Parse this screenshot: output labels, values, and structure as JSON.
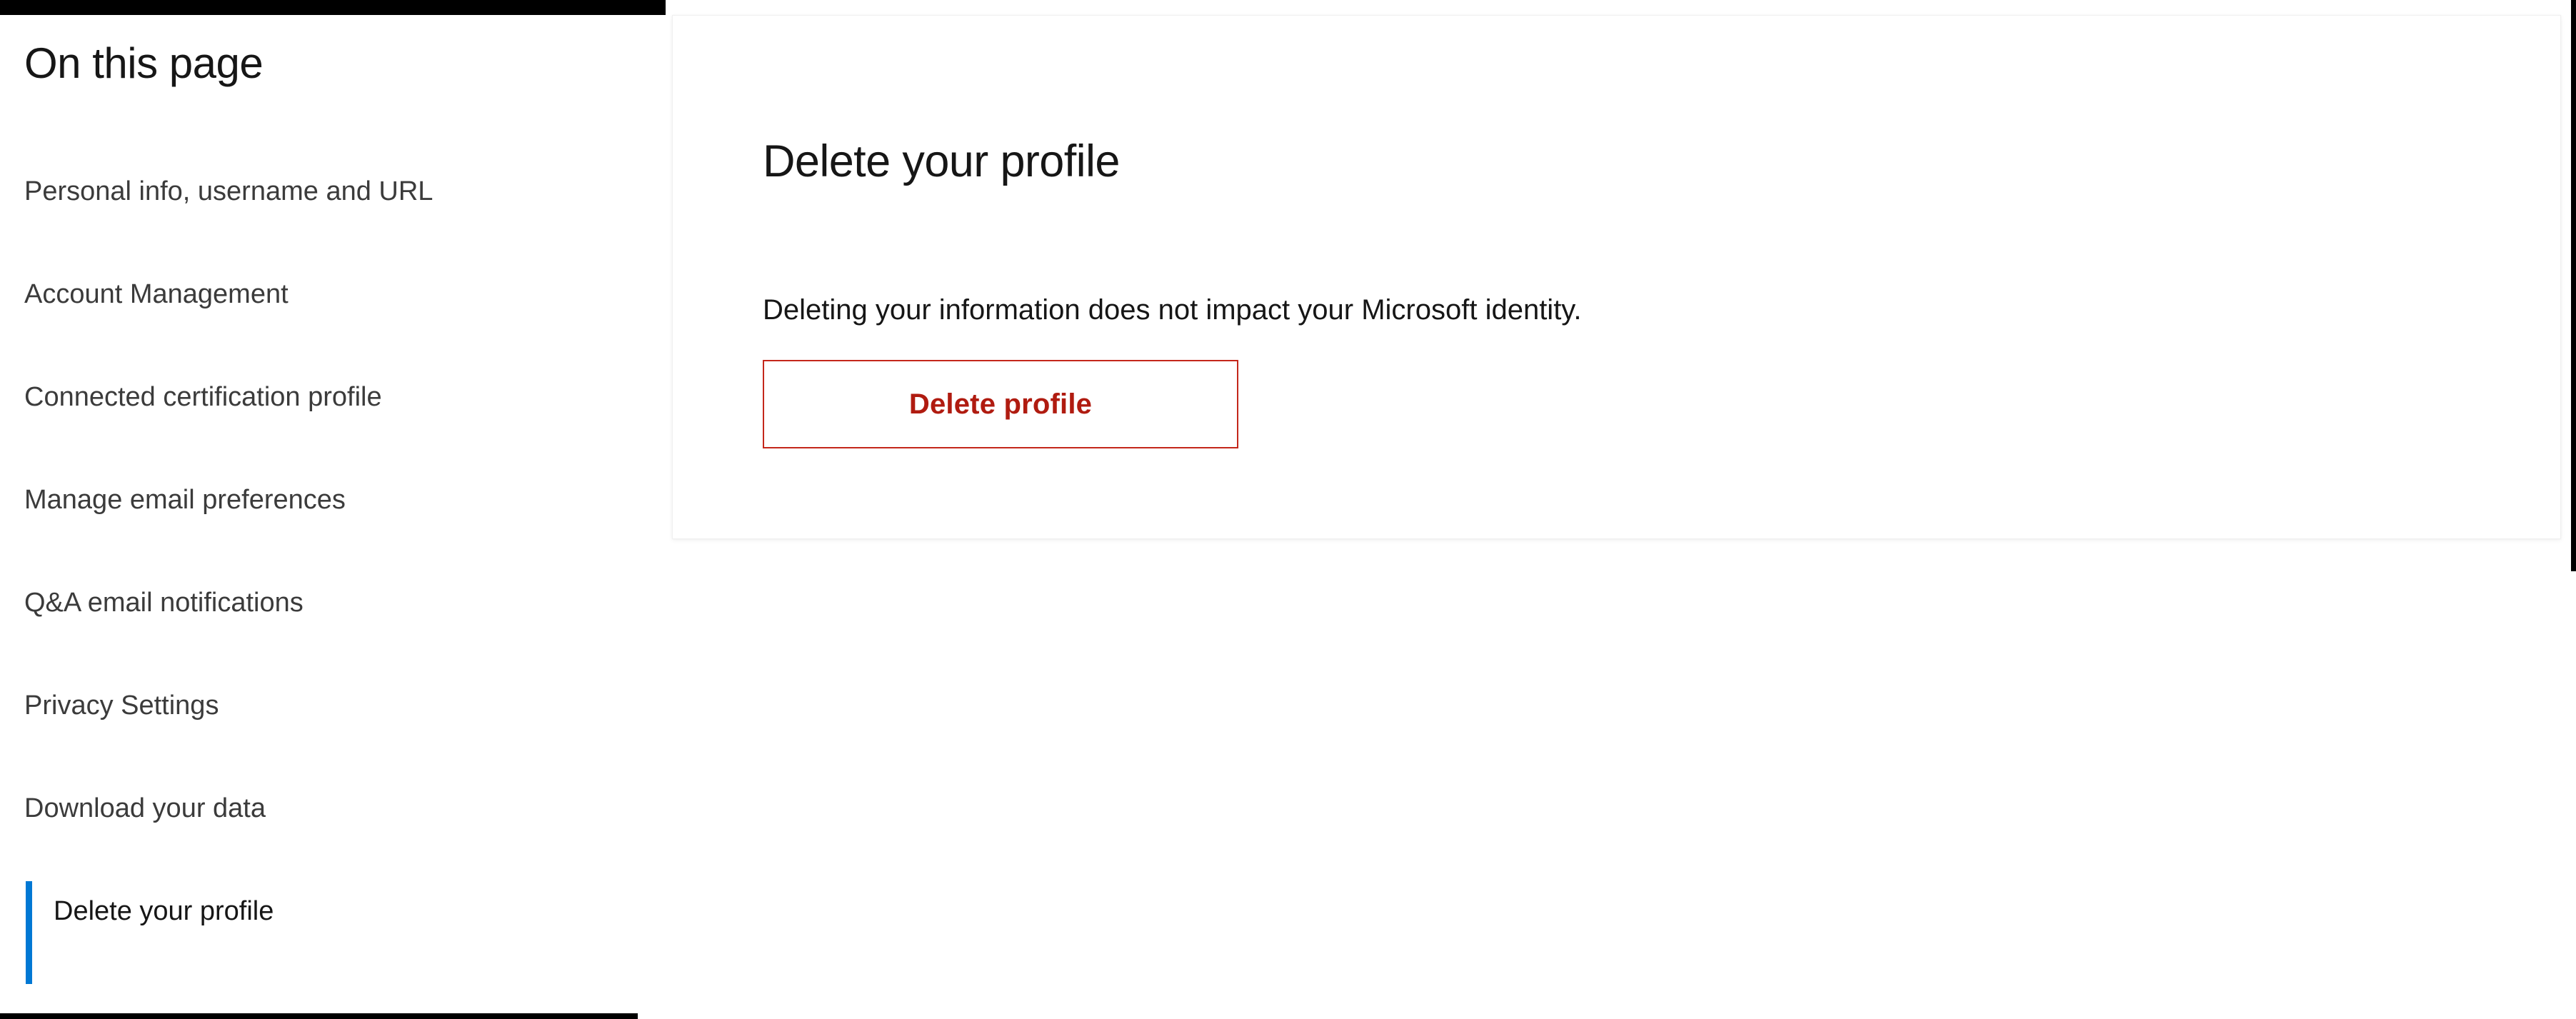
{
  "decor": {
    "top_strip_color": "#000000",
    "right_rule_color": "#000000",
    "bottom_rule_color": "#000000"
  },
  "sidebar": {
    "title": "On this page",
    "active_index": 7,
    "active_indicator_color": "#0078d4",
    "items": [
      {
        "label": "Personal info, username and URL"
      },
      {
        "label": "Account Management"
      },
      {
        "label": "Connected certification profile"
      },
      {
        "label": "Manage email preferences"
      },
      {
        "label": "Q&A email notifications"
      },
      {
        "label": "Privacy Settings"
      },
      {
        "label": "Download your data"
      },
      {
        "label": "Delete your profile"
      }
    ]
  },
  "main": {
    "heading": "Delete your profile",
    "body": "Deleting your information does not impact your Microsoft identity.",
    "delete_button": {
      "label": "Delete profile",
      "border_color": "#c4271b",
      "text_color": "#b01b10"
    }
  }
}
